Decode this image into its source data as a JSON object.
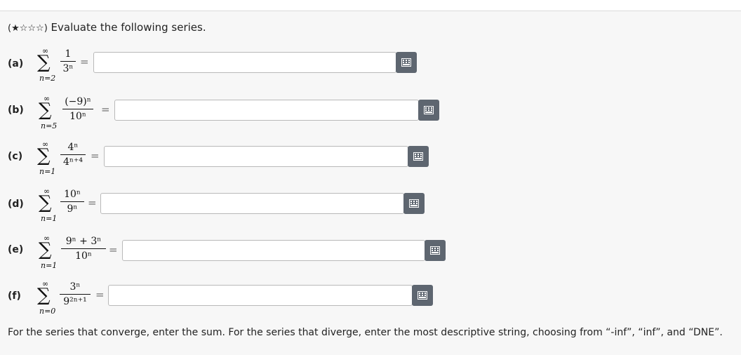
{
  "question": {
    "difficulty_stars": "(★☆☆☆)",
    "prompt": "Evaluate the following series."
  },
  "parts": [
    {
      "label": "(a)",
      "upper": "∞",
      "lower": "n=2",
      "numerator": "1",
      "denominator": "3ⁿ",
      "answer": ""
    },
    {
      "label": "(b)",
      "upper": "∞",
      "lower": "n=5",
      "numerator": "(−9)ⁿ",
      "denominator": "10ⁿ",
      "answer": ""
    },
    {
      "label": "(c)",
      "upper": "∞",
      "lower": "n=1",
      "numerator": "4ⁿ",
      "denominator": "4ⁿ⁺⁴",
      "answer": ""
    },
    {
      "label": "(d)",
      "upper": "∞",
      "lower": "n=1",
      "numerator": "10ⁿ",
      "denominator": "9ⁿ",
      "answer": ""
    },
    {
      "label": "(e)",
      "upper": "∞",
      "lower": "n=1",
      "numerator": "9ⁿ + 3ⁿ",
      "denominator": "10ⁿ",
      "answer": ""
    },
    {
      "label": "(f)",
      "upper": "∞",
      "lower": "n=0",
      "numerator": "3ⁿ",
      "denominator": "9²ⁿ⁺¹",
      "answer": ""
    }
  ],
  "equals": "=",
  "footer": "For the series that converge, enter the sum. For the series that diverge, enter the most descriptive string, choosing from “-inf”, “inf”, and “DNE”.",
  "icons": {
    "keyboard": "keyboard-grid-icon"
  },
  "colors": {
    "keyboard_button": "#5e6670",
    "input_border": "#b9b9b9"
  }
}
